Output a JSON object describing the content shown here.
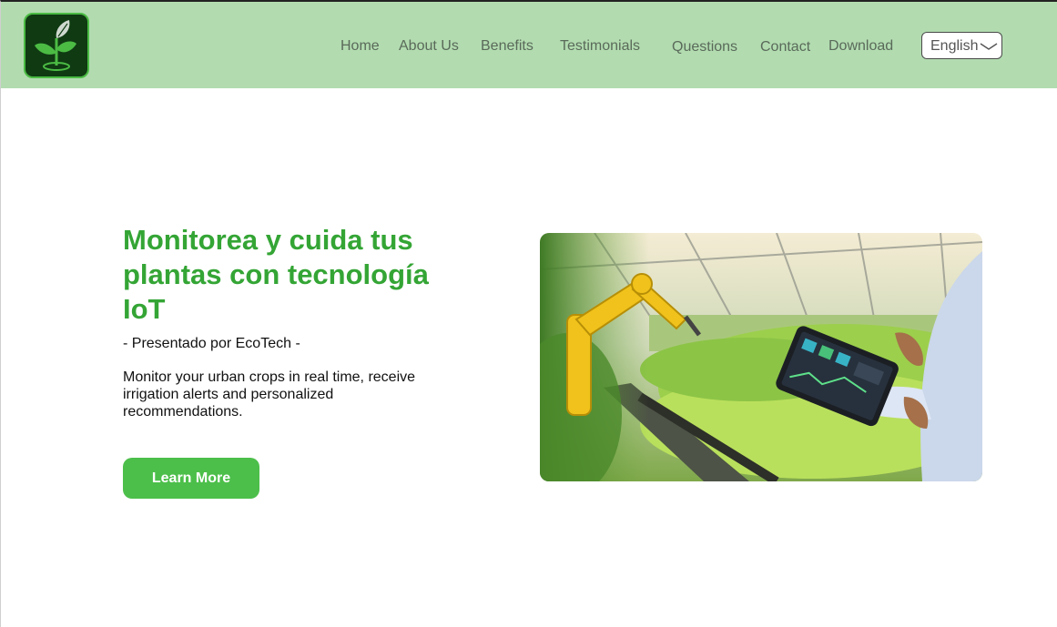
{
  "header": {
    "logo": {
      "icon": "sprout-icon"
    },
    "nav": [
      {
        "label": "Home"
      },
      {
        "label": "About Us"
      },
      {
        "label": "Benefits"
      },
      {
        "label": "Testimonials"
      },
      {
        "label": "Questions"
      },
      {
        "label": "Contact"
      },
      {
        "label": "Download"
      }
    ],
    "language": {
      "selected": "English",
      "icon": "chevron-down-icon"
    }
  },
  "hero": {
    "title": "Monitorea y cuida tus plantas con tecnología IoT",
    "subtitle": "- Presentado por EcoTech -",
    "description": "Monitor your urban crops in real time, receive irrigation alerts and personalized recommendations.",
    "cta_label": "Learn More",
    "image": {
      "subject": "greenhouse-robot-arm-tablet-photo"
    }
  },
  "colors": {
    "header_bg": "#b2dcb0",
    "accent": "#4cbf4a",
    "title": "#34a535"
  }
}
